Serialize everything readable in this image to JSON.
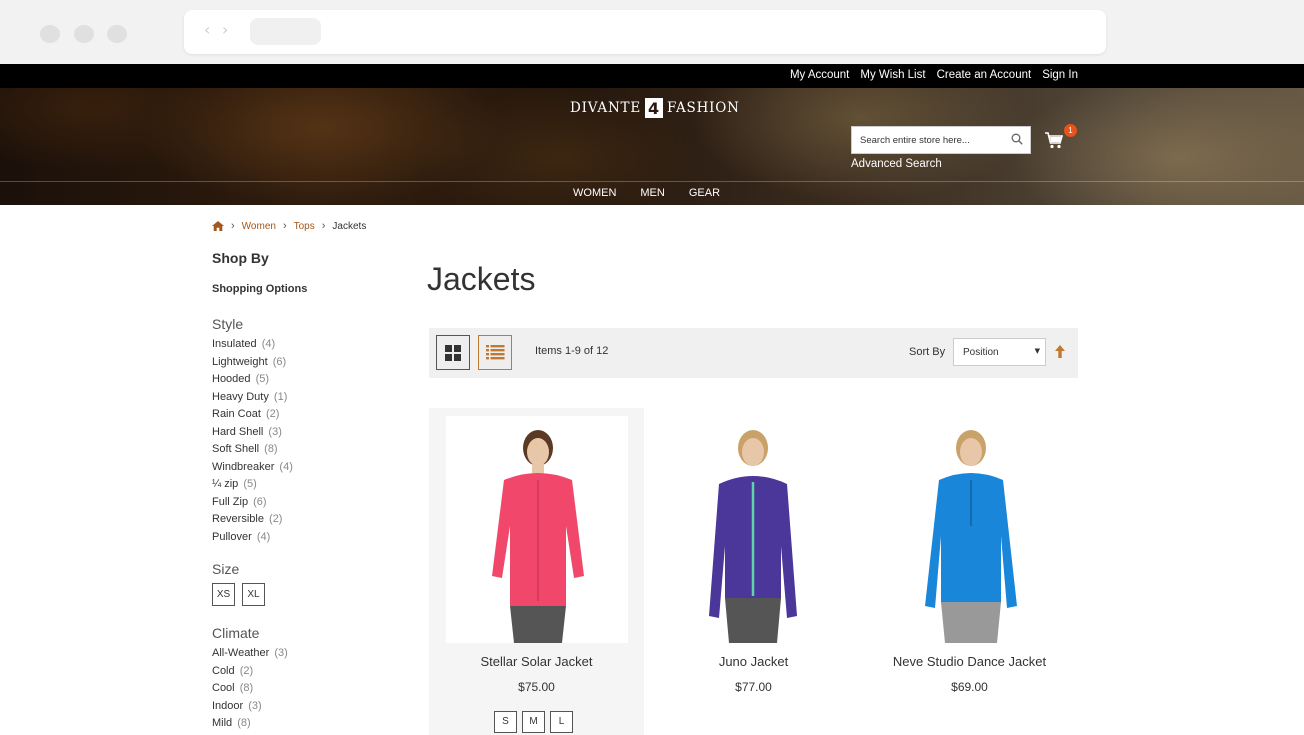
{
  "header": {
    "top_links": [
      "My Account",
      "My Wish List",
      "Create an Account",
      "Sign In"
    ],
    "logo_left": "DIVANTE",
    "logo_mark": "4",
    "logo_right": "FASHION",
    "search_placeholder": "Search entire store here...",
    "cart_count": "1",
    "advanced_search": "Advanced Search",
    "nav": [
      "WOMEN",
      "MEN",
      "GEAR"
    ],
    "accent_color": "#e8521b"
  },
  "breadcrumb": {
    "items": [
      "Women",
      "Tops"
    ],
    "current": "Jackets",
    "separator": "›"
  },
  "sidebar": {
    "shop_by": "Shop By",
    "shopping_options": "Shopping Options",
    "style": {
      "title": "Style",
      "items": [
        {
          "label": "Insulated",
          "count": "(4)"
        },
        {
          "label": "Lightweight",
          "count": "(6)"
        },
        {
          "label": "Hooded",
          "count": "(5)"
        },
        {
          "label": "Heavy Duty",
          "count": "(1)"
        },
        {
          "label": "Rain Coat",
          "count": "(2)"
        },
        {
          "label": "Hard Shell",
          "count": "(3)"
        },
        {
          "label": "Soft Shell",
          "count": "(8)"
        },
        {
          "label": "Windbreaker",
          "count": "(4)"
        },
        {
          "label": "¼ zip",
          "count": "(5)"
        },
        {
          "label": "Full Zip",
          "count": "(6)"
        },
        {
          "label": "Reversible",
          "count": "(2)"
        },
        {
          "label": "Pullover",
          "count": "(4)"
        }
      ]
    },
    "size": {
      "title": "Size",
      "options": [
        "XS",
        "XL"
      ]
    },
    "climate": {
      "title": "Climate",
      "items": [
        {
          "label": "All-Weather",
          "count": "(3)"
        },
        {
          "label": "Cold",
          "count": "(2)"
        },
        {
          "label": "Cool",
          "count": "(8)"
        },
        {
          "label": "Indoor",
          "count": "(3)"
        },
        {
          "label": "Mild",
          "count": "(8)"
        }
      ]
    }
  },
  "main": {
    "title": "Jackets",
    "toolbar": {
      "items_count": "Items 1-9 of 12",
      "sort_label": "Sort By",
      "sort_value": "Position"
    },
    "products": [
      {
        "name": "Stellar Solar Jacket",
        "price": "$75.00",
        "sizes": [
          "S",
          "M",
          "L"
        ],
        "color": "#f0476b"
      },
      {
        "name": "Juno Jacket",
        "price": "$77.00",
        "sizes": [],
        "color": "#4b3699"
      },
      {
        "name": "Neve Studio Dance Jacket",
        "price": "$69.00",
        "sizes": [],
        "color": "#1a86d9"
      }
    ]
  }
}
